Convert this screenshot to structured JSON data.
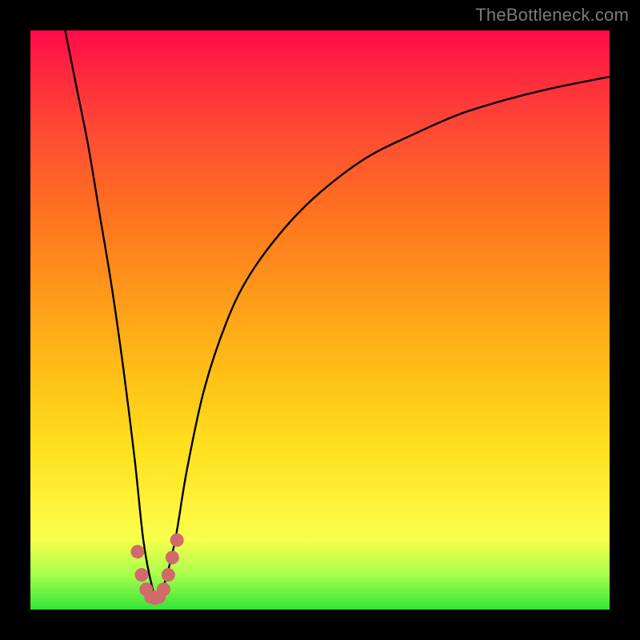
{
  "watermark": "TheBottleneck.com",
  "chart_data": {
    "type": "line",
    "title": "",
    "xlabel": "",
    "ylabel": "",
    "xlim": [
      0,
      100
    ],
    "ylim": [
      0,
      100
    ],
    "grid": false,
    "series": [
      {
        "name": "bottleneck-curve",
        "color": "#000000",
        "x": [
          6,
          8,
          10,
          12,
          14,
          16,
          18,
          19.5,
          21,
          22,
          23,
          25,
          27,
          30,
          34,
          38,
          44,
          50,
          58,
          66,
          74,
          82,
          90,
          100
        ],
        "y": [
          100,
          90,
          80,
          68,
          56,
          42,
          26,
          12,
          4,
          2,
          4,
          12,
          24,
          38,
          50,
          58,
          66,
          72,
          78,
          82,
          85.5,
          88,
          90,
          92
        ]
      }
    ],
    "highlight": {
      "name": "valley-marker",
      "color": "#d16a6a",
      "x": [
        18.5,
        19.2,
        20,
        20.8,
        21.5,
        22.2,
        23,
        23.8,
        24.5,
        25.3
      ],
      "y": [
        10,
        6,
        3.5,
        2.2,
        2,
        2.2,
        3.5,
        6,
        9,
        12
      ]
    }
  }
}
